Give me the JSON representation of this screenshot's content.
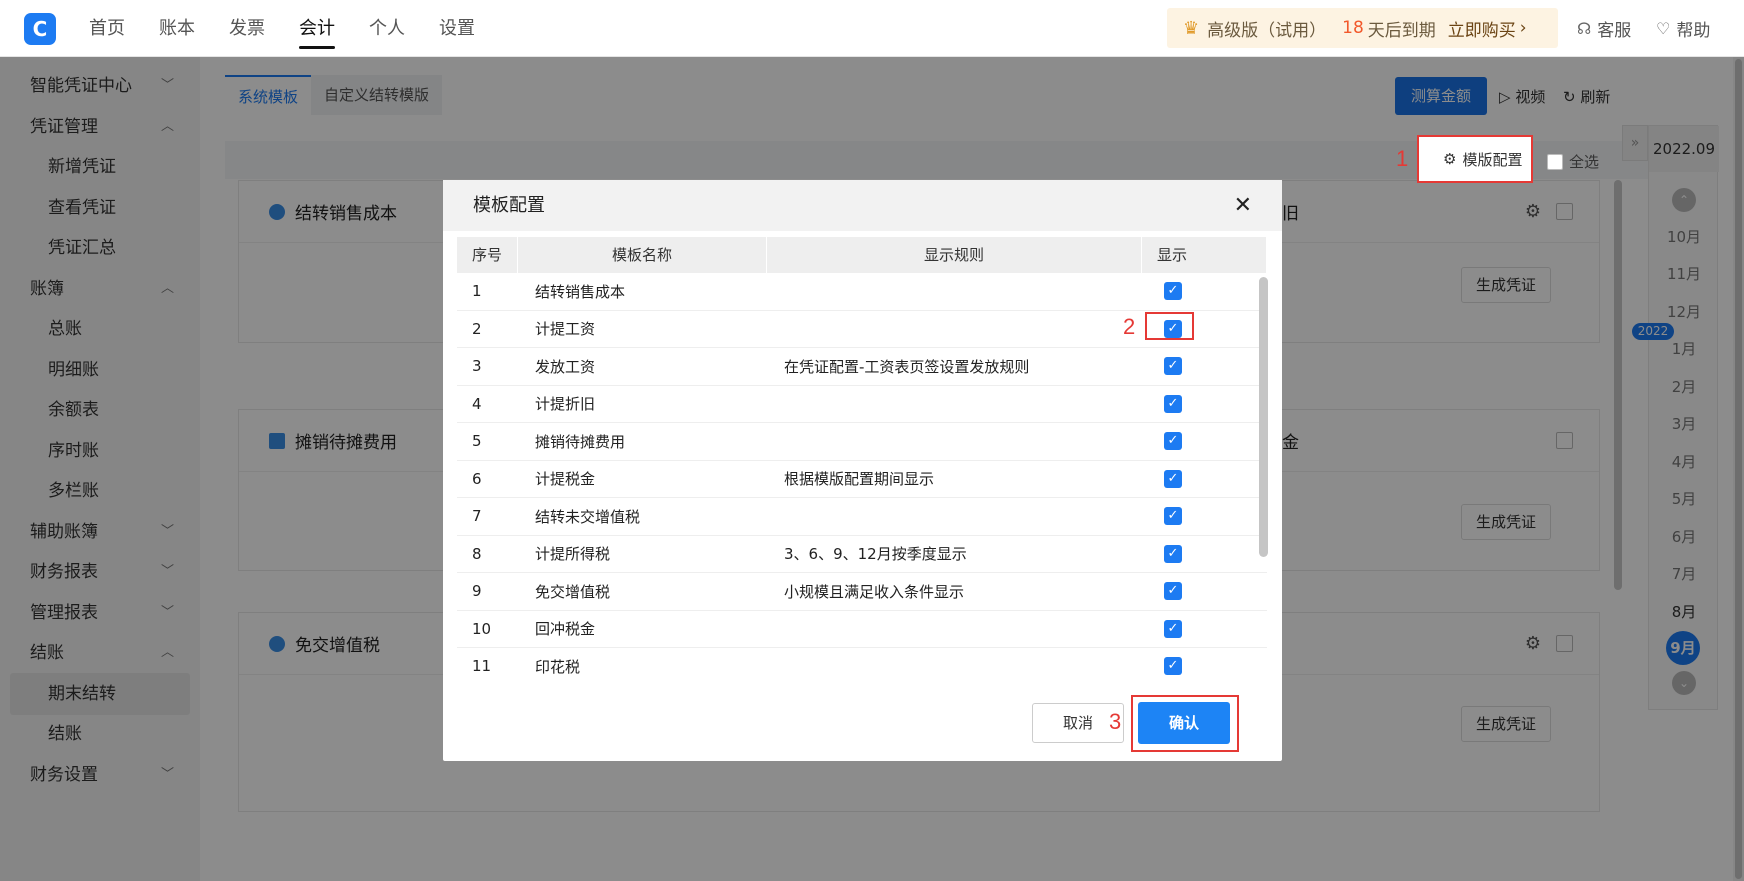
{
  "topnav": {
    "logo": "C",
    "items": [
      "首页",
      "账本",
      "发票",
      "会计",
      "个人",
      "设置"
    ],
    "active_index": 3
  },
  "promo": {
    "edition": "高级版（试用）",
    "days": "18",
    "days_text": "天后到期",
    "buy": "立即购买"
  },
  "top_right": {
    "service": "客服",
    "help": "帮助"
  },
  "sidebar": {
    "items": [
      {
        "label": "智能凭证中心",
        "type": "group",
        "arrow": "down"
      },
      {
        "label": "凭证管理",
        "type": "group",
        "arrow": "up"
      },
      {
        "label": "新增凭证",
        "type": "sub"
      },
      {
        "label": "查看凭证",
        "type": "sub"
      },
      {
        "label": "凭证汇总",
        "type": "sub"
      },
      {
        "label": "账簿",
        "type": "group",
        "arrow": "up"
      },
      {
        "label": "总账",
        "type": "sub"
      },
      {
        "label": "明细账",
        "type": "sub"
      },
      {
        "label": "余额表",
        "type": "sub"
      },
      {
        "label": "序时账",
        "type": "sub"
      },
      {
        "label": "多栏账",
        "type": "sub"
      },
      {
        "label": "辅助账簿",
        "type": "group",
        "arrow": "down"
      },
      {
        "label": "财务报表",
        "type": "group",
        "arrow": "down"
      },
      {
        "label": "管理报表",
        "type": "group",
        "arrow": "down"
      },
      {
        "label": "结账",
        "type": "group",
        "arrow": "up"
      },
      {
        "label": "期末结转",
        "type": "sub",
        "selected": true
      },
      {
        "label": "结账",
        "type": "sub"
      },
      {
        "label": "财务设置",
        "type": "group",
        "arrow": "down"
      }
    ]
  },
  "main": {
    "tabs": [
      "系统模板",
      "自定义结转模版"
    ],
    "calc_button": "测算金额",
    "video": "视频",
    "refresh": "刷新",
    "template_config": "模版配置",
    "select_all": "全选",
    "cards": [
      {
        "title": "结转销售成本",
        "right_fragment": "旧",
        "button": "生成凭证"
      },
      {
        "title": "摊销待摊费用",
        "right_fragment": "金",
        "button": "生成凭证"
      },
      {
        "title": "免交增值税",
        "right_fragment": "",
        "button": "生成凭证"
      }
    ]
  },
  "rail": {
    "top": "2022.09",
    "year_badge": "2022",
    "months": [
      "10月",
      "11月",
      "12月",
      "1月",
      "2月",
      "3月",
      "4月",
      "5月",
      "6月",
      "7月",
      "8月",
      "9月"
    ],
    "current": "9月"
  },
  "modal": {
    "title": "模板配置",
    "headers": [
      "序号",
      "模板名称",
      "显示规则",
      "显示"
    ],
    "rows": [
      {
        "no": "1",
        "name": "结转销售成本",
        "rule": "",
        "show": true
      },
      {
        "no": "2",
        "name": "计提工资",
        "rule": "",
        "show": true
      },
      {
        "no": "3",
        "name": "发放工资",
        "rule": "在凭证配置-工资表页签设置发放规则",
        "show": true
      },
      {
        "no": "4",
        "name": "计提折旧",
        "rule": "",
        "show": true
      },
      {
        "no": "5",
        "name": "摊销待摊费用",
        "rule": "",
        "show": true
      },
      {
        "no": "6",
        "name": "计提税金",
        "rule": "根据模版配置期间显示",
        "show": true
      },
      {
        "no": "7",
        "name": "结转未交增值税",
        "rule": "",
        "show": true
      },
      {
        "no": "8",
        "name": "计提所得税",
        "rule": "3、6、9、12月按季度显示",
        "show": true
      },
      {
        "no": "9",
        "name": "免交增值税",
        "rule": "小规模且满足收入条件显示",
        "show": true
      },
      {
        "no": "10",
        "name": "回冲税金",
        "rule": "",
        "show": true
      },
      {
        "no": "11",
        "name": "印花税",
        "rule": "",
        "show": true
      }
    ],
    "cancel": "取消",
    "confirm": "确认"
  },
  "annotations": [
    "1",
    "2",
    "3"
  ],
  "colors": {
    "accent": "#1d7bf2",
    "annotation_red": "#e53935",
    "promo_days": "#f2592c"
  }
}
